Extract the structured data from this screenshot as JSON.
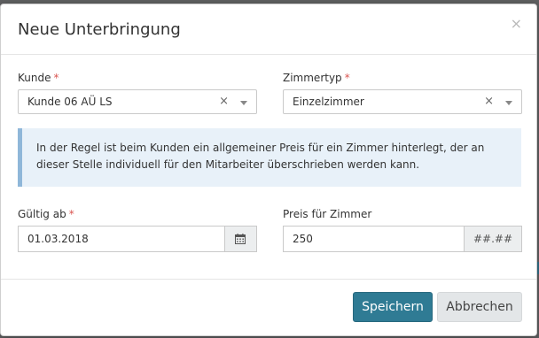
{
  "modal": {
    "title": "Neue Unterbringung",
    "close_label": "×"
  },
  "form": {
    "kunde": {
      "label": "Kunde",
      "required_mark": "*",
      "value": "Kunde 06 AÜ LS",
      "clear": "×"
    },
    "zimmertyp": {
      "label": "Zimmertyp",
      "required_mark": "*",
      "value": "Einzelzimmer",
      "clear": "×"
    },
    "info_text": "In der Regel ist beim Kunden ein allgemeiner Preis für ein Zimmer hinterlegt, der an dieser Stelle individuell für den Mitarbeiter überschrieben werden kann.",
    "gueltig_ab": {
      "label": "Gültig ab",
      "required_mark": "*",
      "value": "01.03.2018"
    },
    "preis": {
      "label": "Preis für Zimmer",
      "value": "250",
      "addon": "##.##"
    }
  },
  "buttons": {
    "save": "Speichern",
    "cancel": "Abbrechen"
  },
  "icons": {
    "calendar": "calendar-icon",
    "close": "close-icon",
    "dropdown": "chevron-down-icon"
  },
  "colors": {
    "primary": "#2f7b94",
    "info_bg": "#e8f1f9",
    "info_border": "#8fb7d9",
    "required": "#d9534f"
  }
}
